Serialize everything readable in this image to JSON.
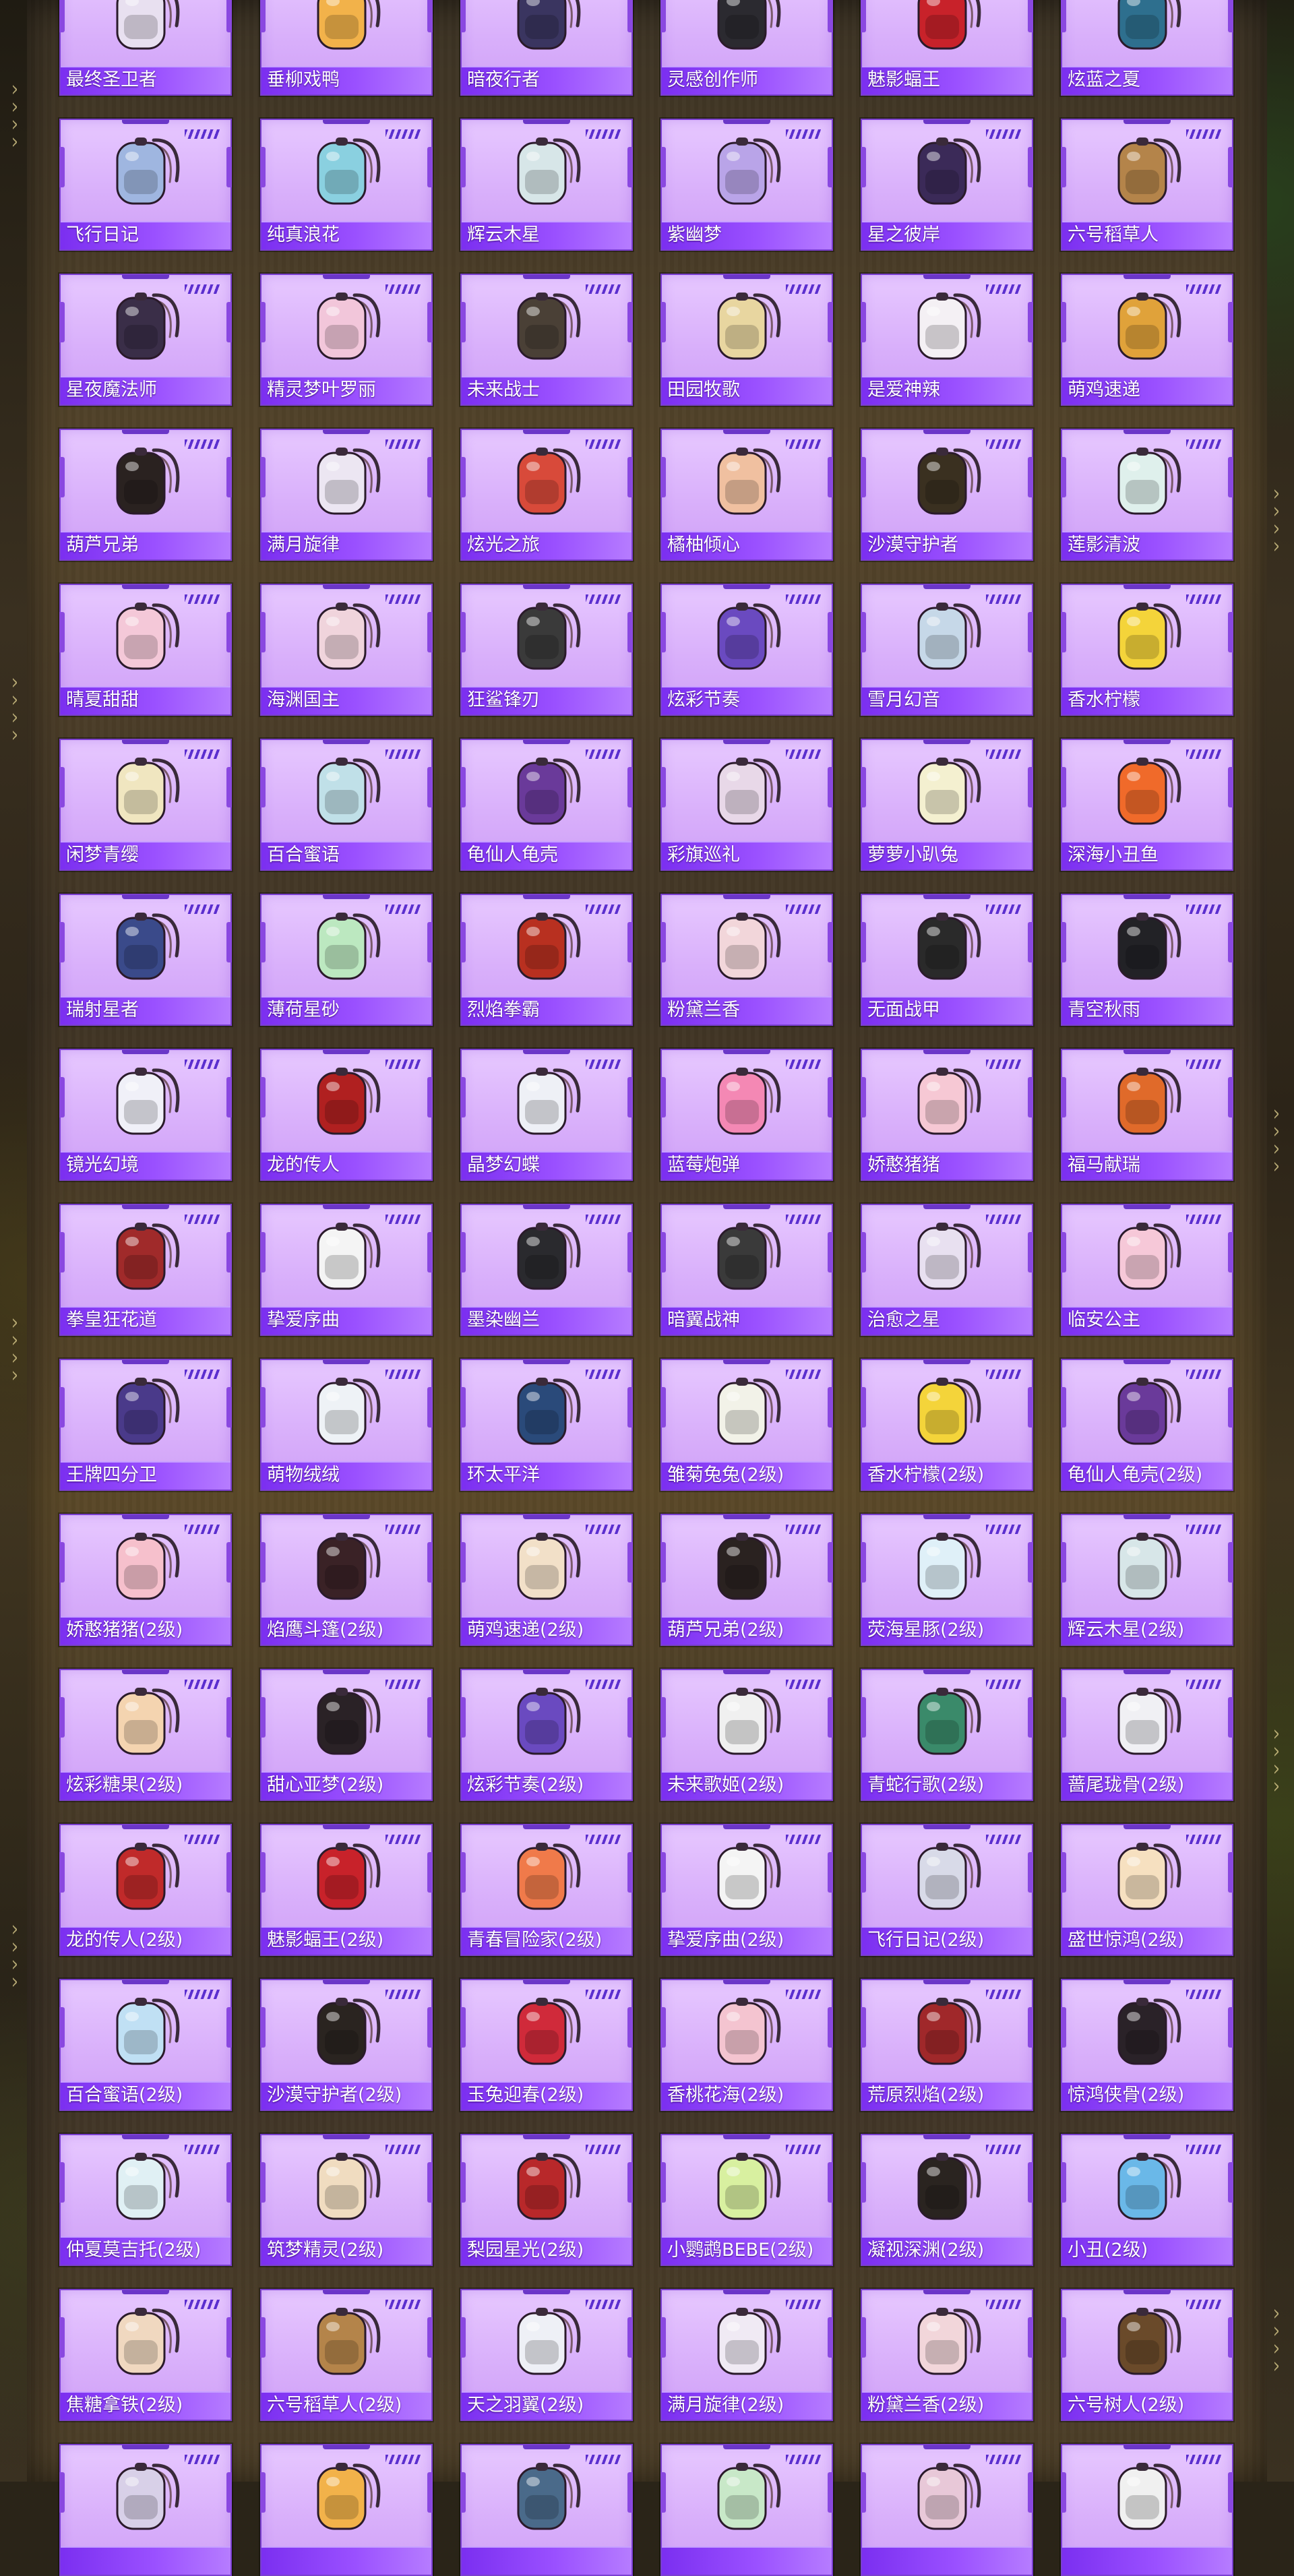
{
  "gallery": {
    "rows": [
      [
        {
          "name": "最终圣卫者",
          "icon": "backpack-icon",
          "color": "#e8e0f0"
        },
        {
          "name": "垂柳戏鸭",
          "icon": "backpack-icon",
          "color": "#f2b24a"
        },
        {
          "name": "暗夜行者",
          "icon": "backpack-icon",
          "color": "#3a3560"
        },
        {
          "name": "灵感创作师",
          "icon": "backpack-icon",
          "color": "#2b2a30"
        },
        {
          "name": "魅影蝠王",
          "icon": "backpack-icon",
          "color": "#c8222a"
        },
        {
          "name": "炫蓝之夏",
          "icon": "backpack-icon",
          "color": "#2e6f8e"
        }
      ],
      [
        {
          "name": "飞行日记",
          "icon": "backpack-icon",
          "color": "#9fb6e0"
        },
        {
          "name": "纯真浪花",
          "icon": "backpack-icon",
          "color": "#8ad0e0"
        },
        {
          "name": "辉云木星",
          "icon": "backpack-icon",
          "color": "#d7e6e8"
        },
        {
          "name": "紫幽梦",
          "icon": "backpack-icon",
          "color": "#b9a4e8"
        },
        {
          "name": "星之彼岸",
          "icon": "backpack-icon",
          "color": "#3b2a58"
        },
        {
          "name": "六号稻草人",
          "icon": "backpack-icon",
          "color": "#b4844a"
        }
      ],
      [
        {
          "name": "星夜魔法师",
          "icon": "backpack-icon",
          "color": "#3a2e48"
        },
        {
          "name": "精灵梦叶罗丽",
          "icon": "backpack-icon",
          "color": "#f2c6da"
        },
        {
          "name": "未来战士",
          "icon": "backpack-icon",
          "color": "#4a4036"
        },
        {
          "name": "田园牧歌",
          "icon": "backpack-icon",
          "color": "#e8d6a0"
        },
        {
          "name": "是爱神辣",
          "icon": "backpack-icon",
          "color": "#f4f0f4"
        },
        {
          "name": "萌鸡速递",
          "icon": "backpack-icon",
          "color": "#e0a23a"
        }
      ],
      [
        {
          "name": "葫芦兄弟",
          "icon": "backpack-icon",
          "color": "#2a2220"
        },
        {
          "name": "满月旋律",
          "icon": "backpack-icon",
          "color": "#ece6f2"
        },
        {
          "name": "炫光之旅",
          "icon": "backpack-icon",
          "color": "#d84a3a"
        },
        {
          "name": "橘柚倾心",
          "icon": "backpack-icon",
          "color": "#f0c0a0"
        },
        {
          "name": "沙漠守护者",
          "icon": "backpack-icon",
          "color": "#3a3020"
        },
        {
          "name": "莲影清波",
          "icon": "backpack-icon",
          "color": "#dff0ec"
        }
      ],
      [
        {
          "name": "晴夏甜甜",
          "icon": "backpack-icon",
          "color": "#f4c8d8"
        },
        {
          "name": "海渊国主",
          "icon": "backpack-icon",
          "color": "#f0d4dc"
        },
        {
          "name": "狂鲨锋刃",
          "icon": "backpack-icon",
          "color": "#3a3a3a"
        },
        {
          "name": "炫彩节奏",
          "icon": "backpack-icon",
          "color": "#6a4ac0"
        },
        {
          "name": "雪月幻音",
          "icon": "backpack-icon",
          "color": "#c6d8e8"
        },
        {
          "name": "香水柠檬",
          "icon": "backpack-icon",
          "color": "#f4d43a"
        }
      ],
      [
        {
          "name": "闲梦青缨",
          "icon": "backpack-icon",
          "color": "#f0e6c0"
        },
        {
          "name": "百合蜜语",
          "icon": "backpack-icon",
          "color": "#c0e0e8"
        },
        {
          "name": "龟仙人龟壳",
          "icon": "backpack-icon",
          "color": "#6a3a9a"
        },
        {
          "name": "彩旗巡礼",
          "icon": "backpack-icon",
          "color": "#e8d8e8"
        },
        {
          "name": "萝萝小趴兔",
          "icon": "backpack-icon",
          "color": "#f4f0d0"
        },
        {
          "name": "深海小丑鱼",
          "icon": "backpack-icon",
          "color": "#f06a2a"
        }
      ],
      [
        {
          "name": "瑞射星者",
          "icon": "backpack-icon",
          "color": "#3a4a8a"
        },
        {
          "name": "薄荷星砂",
          "icon": "backpack-icon",
          "color": "#bce8c0"
        },
        {
          "name": "烈焰拳霸",
          "icon": "backpack-icon",
          "color": "#b83020"
        },
        {
          "name": "粉黛兰香",
          "icon": "backpack-icon",
          "color": "#f2d6da"
        },
        {
          "name": "无面战甲",
          "icon": "backpack-icon",
          "color": "#2a2a2a"
        },
        {
          "name": "青空秋雨",
          "icon": "backpack-icon",
          "color": "#222226"
        }
      ],
      [
        {
          "name": "镜光幻境",
          "icon": "backpack-icon",
          "color": "#f0f0f8"
        },
        {
          "name": "龙的传人",
          "icon": "backpack-icon",
          "color": "#b02020"
        },
        {
          "name": "晶梦幻蝶",
          "icon": "backpack-icon",
          "color": "#eef0f6"
        },
        {
          "name": "蓝莓炮弹",
          "icon": "backpack-icon",
          "color": "#f488b4"
        },
        {
          "name": "娇憨猪猪",
          "icon": "backpack-icon",
          "color": "#f6c8d4"
        },
        {
          "name": "福马献瑞",
          "icon": "backpack-icon",
          "color": "#e06a2a"
        }
      ],
      [
        {
          "name": "拳皇狂花道",
          "icon": "backpack-icon",
          "color": "#a02a2a"
        },
        {
          "name": "挚爱序曲",
          "icon": "backpack-icon",
          "color": "#f4f4f4"
        },
        {
          "name": "墨染幽兰",
          "icon": "backpack-icon",
          "color": "#2a2a2e"
        },
        {
          "name": "暗翼战神",
          "icon": "backpack-icon",
          "color": "#3a3a3a"
        },
        {
          "name": "治愈之星",
          "icon": "backpack-icon",
          "color": "#e8e0f0"
        },
        {
          "name": "临安公主",
          "icon": "backpack-icon",
          "color": "#f6c8d8"
        }
      ],
      [
        {
          "name": "王牌四分卫",
          "icon": "backpack-icon",
          "color": "#4a3a8a"
        },
        {
          "name": "萌物绒绒",
          "icon": "backpack-icon",
          "color": "#eef2f6"
        },
        {
          "name": "环太平洋",
          "icon": "backpack-icon",
          "color": "#2a4a7a"
        },
        {
          "name": "雏菊兔兔(2级)",
          "icon": "backpack-icon",
          "color": "#f2f2e8"
        },
        {
          "name": "香水柠檬(2级)",
          "icon": "backpack-icon",
          "color": "#f4d43a"
        },
        {
          "name": "龟仙人龟壳(2级)",
          "icon": "backpack-icon",
          "color": "#6a3a9a"
        }
      ],
      [
        {
          "name": "娇憨猪猪(2级)",
          "icon": "backpack-icon",
          "color": "#f6c0cc"
        },
        {
          "name": "焰鹰斗篷(2级)",
          "icon": "backpack-icon",
          "color": "#3a2226"
        },
        {
          "name": "萌鸡速递(2级)",
          "icon": "backpack-icon",
          "color": "#f2e0c8"
        },
        {
          "name": "葫芦兄弟(2级)",
          "icon": "backpack-icon",
          "color": "#2a2220"
        },
        {
          "name": "荧海星豚(2级)",
          "icon": "backpack-icon",
          "color": "#dff0f8"
        },
        {
          "name": "辉云木星(2级)",
          "icon": "backpack-icon",
          "color": "#d7e6e8"
        }
      ],
      [
        {
          "name": "炫彩糖果(2级)",
          "icon": "backpack-icon",
          "color": "#f4d4b0"
        },
        {
          "name": "甜心亚梦(2级)",
          "icon": "backpack-icon",
          "color": "#2a2226"
        },
        {
          "name": "炫彩节奏(2级)",
          "icon": "backpack-icon",
          "color": "#6a4ac0"
        },
        {
          "name": "未来歌姬(2级)",
          "icon": "backpack-icon",
          "color": "#f0f0f0"
        },
        {
          "name": "青蛇行歌(2级)",
          "icon": "backpack-icon",
          "color": "#3a8a6a"
        },
        {
          "name": "蔷尾珑骨(2级)",
          "icon": "backpack-icon",
          "color": "#f0f0f4"
        }
      ],
      [
        {
          "name": "龙的传人(2级)",
          "icon": "backpack-icon",
          "color": "#c02a2a"
        },
        {
          "name": "魅影蝠王(2级)",
          "icon": "backpack-icon",
          "color": "#c8222a"
        },
        {
          "name": "青春冒险家(2级)",
          "icon": "backpack-icon",
          "color": "#f07a4a"
        },
        {
          "name": "挚爱序曲(2级)",
          "icon": "backpack-icon",
          "color": "#f4f4f4"
        },
        {
          "name": "飞行日记(2级)",
          "icon": "backpack-icon",
          "color": "#d8dae8"
        },
        {
          "name": "盛世惊鸿(2级)",
          "icon": "backpack-icon",
          "color": "#f6e0c0"
        }
      ],
      [
        {
          "name": "百合蜜语(2级)",
          "icon": "backpack-icon",
          "color": "#c0e0f4"
        },
        {
          "name": "沙漠守护者(2级)",
          "icon": "backpack-icon",
          "color": "#2a2420"
        },
        {
          "name": "玉兔迎春(2级)",
          "icon": "backpack-icon",
          "color": "#d02a3a"
        },
        {
          "name": "香桃花海(2级)",
          "icon": "backpack-icon",
          "color": "#f4c4d0"
        },
        {
          "name": "荒原烈焰(2级)",
          "icon": "backpack-icon",
          "color": "#a0282a"
        },
        {
          "name": "惊鸿侠骨(2级)",
          "icon": "backpack-icon",
          "color": "#2a2228"
        }
      ],
      [
        {
          "name": "仲夏莫吉托(2级)",
          "icon": "backpack-icon",
          "color": "#e0f0f4"
        },
        {
          "name": "筑梦精灵(2级)",
          "icon": "backpack-icon",
          "color": "#f0dcc0"
        },
        {
          "name": "梨园星光(2级)",
          "icon": "backpack-icon",
          "color": "#b8282a"
        },
        {
          "name": "小鹦鹉BEBE(2级)",
          "icon": "backpack-icon",
          "color": "#d8f0a0"
        },
        {
          "name": "凝视深渊(2级)",
          "icon": "backpack-icon",
          "color": "#2a2420"
        },
        {
          "name": "小丑(2级)",
          "icon": "backpack-icon",
          "color": "#6ab8e8"
        }
      ],
      [
        {
          "name": "焦糖拿铁(2级)",
          "icon": "backpack-icon",
          "color": "#f0d8c0"
        },
        {
          "name": "六号稻草人(2级)",
          "icon": "backpack-icon",
          "color": "#b4844a"
        },
        {
          "name": "天之羽翼(2级)",
          "icon": "backpack-icon",
          "color": "#eef0f6"
        },
        {
          "name": "满月旋律(2级)",
          "icon": "backpack-icon",
          "color": "#f0eaf4"
        },
        {
          "name": "粉黛兰香(2级)",
          "icon": "backpack-icon",
          "color": "#f2d6da"
        },
        {
          "name": "六号树人(2级)",
          "icon": "backpack-icon",
          "color": "#6a4a2a"
        }
      ],
      [
        {
          "name": "",
          "icon": "backpack-icon",
          "color": "#d8d0e8"
        },
        {
          "name": "",
          "icon": "backpack-icon",
          "color": "#f2b24a"
        },
        {
          "name": "",
          "icon": "backpack-icon",
          "color": "#4a6a8a"
        },
        {
          "name": "",
          "icon": "backpack-icon",
          "color": "#c8e8c8"
        },
        {
          "name": "",
          "icon": "backpack-icon",
          "color": "#e8c8d8"
        },
        {
          "name": "",
          "icon": "backpack-icon",
          "color": "#f0f0f0"
        }
      ]
    ]
  },
  "colors": {
    "card_bg": "#dcb6fb",
    "label_bar": "#8a3ff8",
    "card_border": "#7a3fd0",
    "label_text": "#ffffff"
  }
}
